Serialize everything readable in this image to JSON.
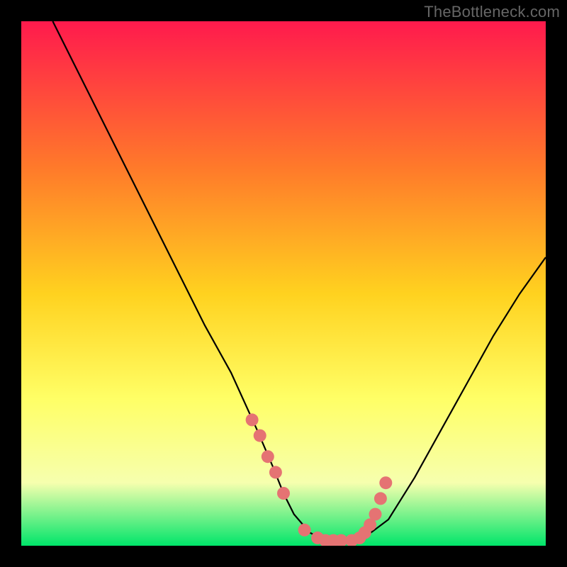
{
  "watermark": {
    "text": "TheBottleneck.com"
  },
  "colors": {
    "background": "#000000",
    "gradient_top": "#ff1a4d",
    "gradient_mid_upper": "#ff7a2a",
    "gradient_mid": "#ffd21f",
    "gradient_mid_lower": "#ffff66",
    "gradient_lower": "#f6ffae",
    "gradient_bottom": "#00e56a",
    "curve": "#000000",
    "dot_fill": "#e57373",
    "dot_stroke": "#c85a5a"
  },
  "chart_data": {
    "type": "line",
    "title": "",
    "xlabel": "",
    "ylabel": "",
    "xlim": [
      0,
      100
    ],
    "ylim": [
      0,
      100
    ],
    "grid": false,
    "legend": false,
    "series": [
      {
        "name": "bottleneck-curve",
        "x": [
          6,
          10,
          15,
          20,
          25,
          30,
          35,
          40,
          45,
          48,
          50,
          52,
          55,
          58,
          60,
          62,
          64,
          66,
          70,
          75,
          80,
          85,
          90,
          95,
          100
        ],
        "y": [
          100,
          92,
          82,
          72,
          62,
          52,
          42,
          33,
          22,
          15,
          10,
          6,
          2.5,
          1,
          1,
          1,
          1,
          2,
          5,
          13,
          22,
          31,
          40,
          48,
          55
        ]
      }
    ],
    "highlight_points": {
      "name": "highlighted-dots",
      "x": [
        44,
        45.5,
        47,
        48.5,
        50,
        54,
        56.5,
        58,
        59.5,
        61,
        63,
        64.5,
        65.5,
        66.5,
        67.5,
        68.5,
        69.5
      ],
      "y": [
        24,
        21,
        17,
        14,
        10,
        3,
        1.5,
        1,
        1,
        1,
        1,
        1.5,
        2.5,
        4,
        6,
        9,
        12
      ]
    }
  }
}
